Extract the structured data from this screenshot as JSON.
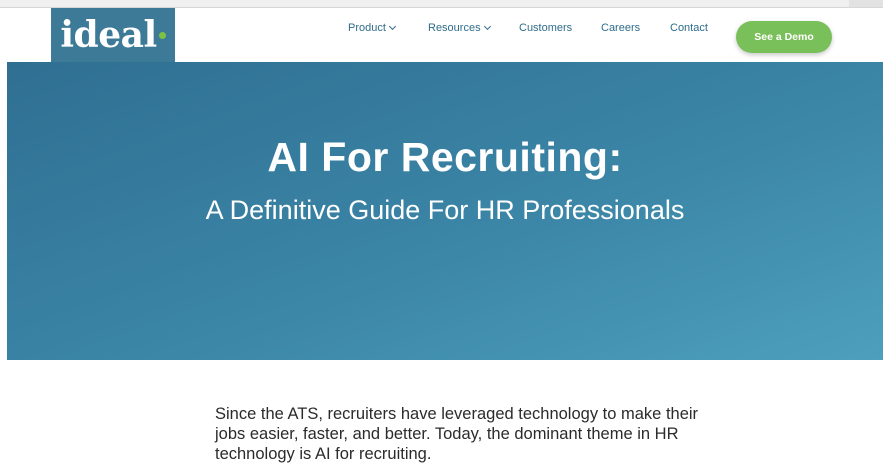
{
  "brand": {
    "logo_text": "ideal",
    "accent": "#7cc242",
    "logo_bg": "#3d7a98"
  },
  "nav": {
    "items": [
      {
        "label": "Product",
        "has_dropdown": true
      },
      {
        "label": "Resources",
        "has_dropdown": true
      },
      {
        "label": "Customers",
        "has_dropdown": false
      },
      {
        "label": "Careers",
        "has_dropdown": false
      },
      {
        "label": "Contact",
        "has_dropdown": false
      }
    ],
    "cta_label": "See a Demo"
  },
  "hero": {
    "title": "AI For Recruiting:",
    "subtitle": "A Definitive Guide For HR Professionals"
  },
  "content": {
    "intro": "Since the ATS, recruiters have leveraged technology to make their jobs easier, faster, and better. Today, the dominant theme in HR technology is AI for recruiting."
  }
}
